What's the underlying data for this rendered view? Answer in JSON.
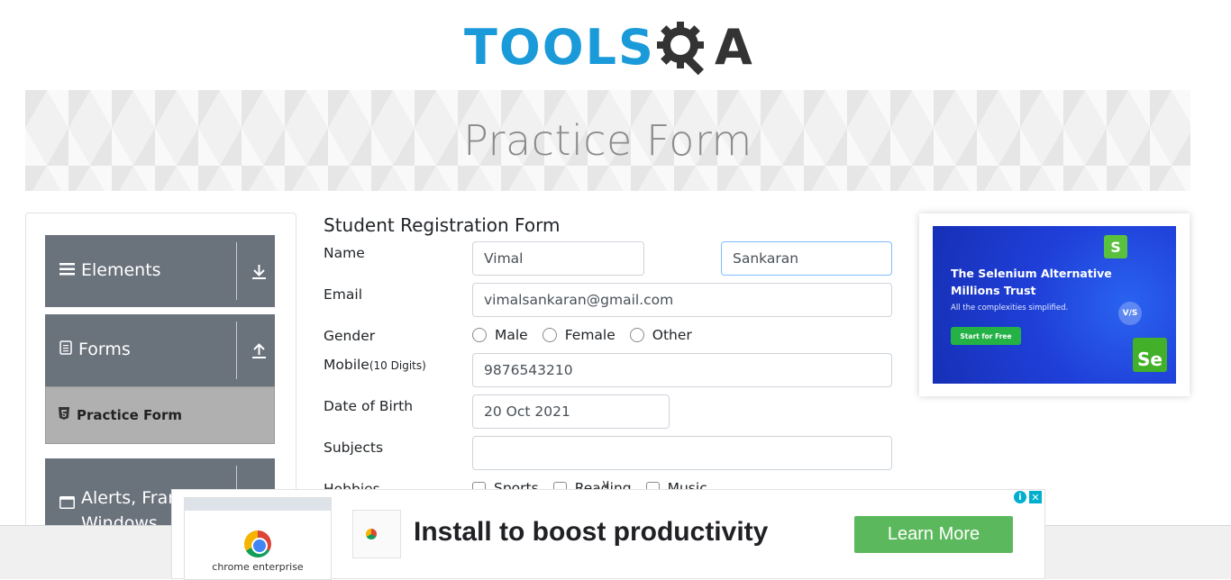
{
  "header": {
    "logo_tools": "TOOLS",
    "logo_qa": "A",
    "colors": {
      "logo_blue": "#1b9ad9",
      "logo_dark": "#333333"
    }
  },
  "banner": {
    "title": "Practice Form"
  },
  "sidebar": {
    "groups": [
      {
        "label": "Elements",
        "icon": "hamburger-icon",
        "arrow": "download-arrow-icon"
      },
      {
        "label": "Forms",
        "icon": "document-icon",
        "arrow": "upload-arrow-icon"
      },
      {
        "label": "Alerts, Frame & Windows",
        "label_line1": "Alerts, Fram",
        "label_line2": "Windows",
        "icon": "window-icon"
      }
    ],
    "active_item": {
      "label": "Practice Form",
      "icon": "html5-icon"
    },
    "colors": {
      "group_bg": "#6a727c",
      "active_bg": "#b0b0b0"
    }
  },
  "form": {
    "title": "Student Registration Form",
    "name": {
      "label": "Name",
      "first": "Vimal",
      "last": "Sankaran"
    },
    "email": {
      "label": "Email",
      "value": "vimalsankaran@gmail.com"
    },
    "gender": {
      "label": "Gender",
      "options": [
        "Male",
        "Female",
        "Other"
      ]
    },
    "mobile": {
      "label": "Mobile",
      "hint": "(10 Digits)",
      "value": "9876543210"
    },
    "dob": {
      "label": "Date of Birth",
      "value": "20 Oct 2021"
    },
    "subjects": {
      "label": "Subjects",
      "value": ""
    },
    "hobbies": {
      "label": "Hobbies",
      "options": [
        "Sports",
        "Reading",
        "Music"
      ]
    }
  },
  "ad_right": {
    "headline_line1": "The Selenium Alternative",
    "headline_line2": "Millions Trust",
    "sub": "All the complexities simplified.",
    "button": "Start for Free",
    "s_logo": "S",
    "se_logo": "Se",
    "vs": "V/S"
  },
  "ad_bottom": {
    "thumb_caption": "chrome enterprise",
    "title": "Install to boost productivity",
    "button": "Learn More",
    "info": "i",
    "close": "✕",
    "chevron": "∨"
  }
}
